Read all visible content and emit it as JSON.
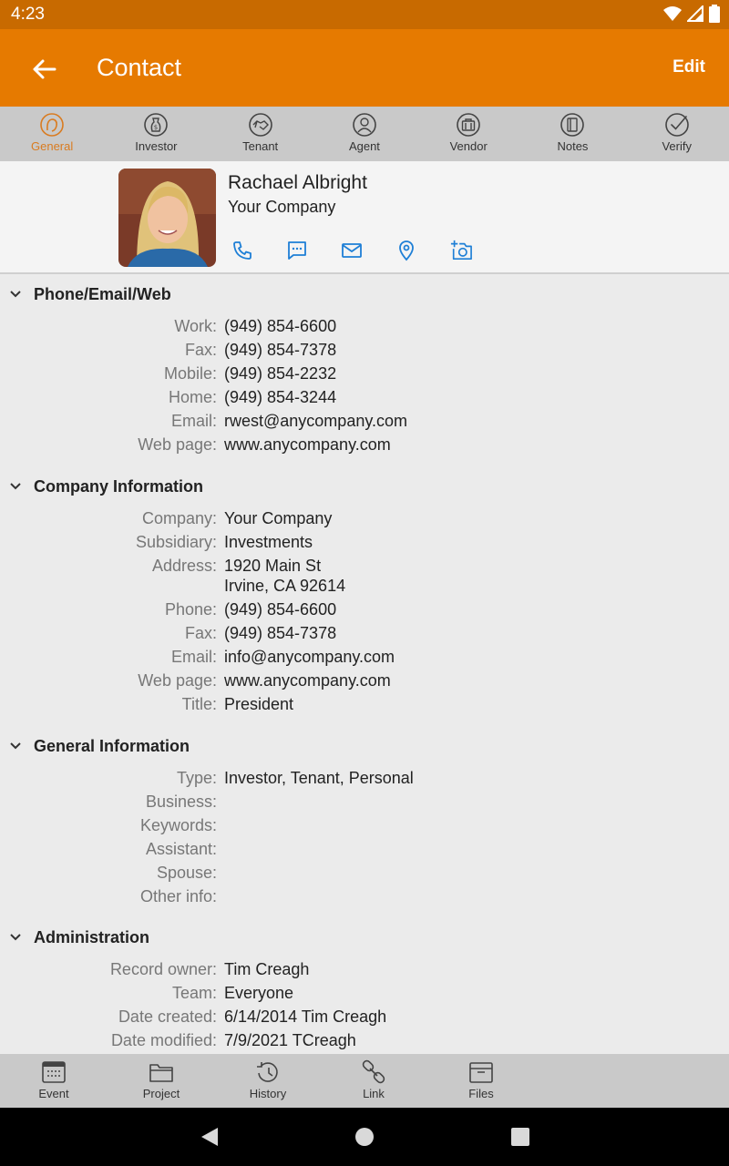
{
  "status": {
    "time": "4:23"
  },
  "app_bar": {
    "title": "Contact",
    "edit_label": "Edit"
  },
  "tabs": [
    {
      "label": "General",
      "icon": "face-icon",
      "active": true
    },
    {
      "label": "Investor",
      "icon": "money-bag-icon"
    },
    {
      "label": "Tenant",
      "icon": "handshake-icon"
    },
    {
      "label": "Agent",
      "icon": "agent-icon"
    },
    {
      "label": "Vendor",
      "icon": "briefcase-icon"
    },
    {
      "label": "Notes",
      "icon": "notes-icon"
    },
    {
      "label": "Verify",
      "icon": "check-icon"
    }
  ],
  "profile": {
    "name": "Rachael Albright",
    "company": "Your Company"
  },
  "sections": {
    "phone": {
      "title": "Phone/Email/Web",
      "rows": [
        {
          "label": "Work:",
          "value": "(949) 854-6600"
        },
        {
          "label": "Fax:",
          "value": "(949) 854-7378"
        },
        {
          "label": "Mobile:",
          "value": "(949) 854-2232"
        },
        {
          "label": "Home:",
          "value": "(949) 854-3244"
        },
        {
          "label": "Email:",
          "value": "rwest@anycompany.com"
        },
        {
          "label": "Web page:",
          "value": "www.anycompany.com"
        }
      ]
    },
    "company": {
      "title": "Company Information",
      "rows": [
        {
          "label": "Company:",
          "value": "Your Company"
        },
        {
          "label": "Subsidiary:",
          "value": "Investments"
        },
        {
          "label": "Address:",
          "value": "1920 Main St",
          "value2": "Irvine, CA 92614"
        },
        {
          "label": "Phone:",
          "value": "(949) 854-6600"
        },
        {
          "label": "Fax:",
          "value": "(949) 854-7378"
        },
        {
          "label": "Email:",
          "value": "info@anycompany.com"
        },
        {
          "label": "Web page:",
          "value": "www.anycompany.com"
        },
        {
          "label": "Title:",
          "value": "President"
        }
      ]
    },
    "general": {
      "title": "General Information",
      "rows": [
        {
          "label": "Type:",
          "value": "Investor, Tenant, Personal"
        },
        {
          "label": "Business:",
          "value": ""
        },
        {
          "label": "Keywords:",
          "value": ""
        },
        {
          "label": "Assistant:",
          "value": ""
        },
        {
          "label": "Spouse:",
          "value": ""
        },
        {
          "label": "Other info:",
          "value": ""
        }
      ]
    },
    "admin": {
      "title": "Administration",
      "rows": [
        {
          "label": "Record owner:",
          "value": "Tim Creagh"
        },
        {
          "label": "Team:",
          "value": "Everyone"
        },
        {
          "label": "Date created:",
          "value": "6/14/2014 Tim Creagh"
        },
        {
          "label": "Date modified:",
          "value": "7/9/2021 TCreagh"
        }
      ]
    }
  },
  "bottom_bar": [
    {
      "label": "Event",
      "icon": "calendar-icon"
    },
    {
      "label": "Project",
      "icon": "folder-icon"
    },
    {
      "label": "History",
      "icon": "history-icon"
    },
    {
      "label": "Link",
      "icon": "link-icon"
    },
    {
      "label": "Files",
      "icon": "files-icon"
    }
  ],
  "colors": {
    "accent": "#e67a00",
    "status_bar": "#c86a00",
    "action_blue": "#1e7fd6",
    "active_tab": "#d97b20"
  }
}
